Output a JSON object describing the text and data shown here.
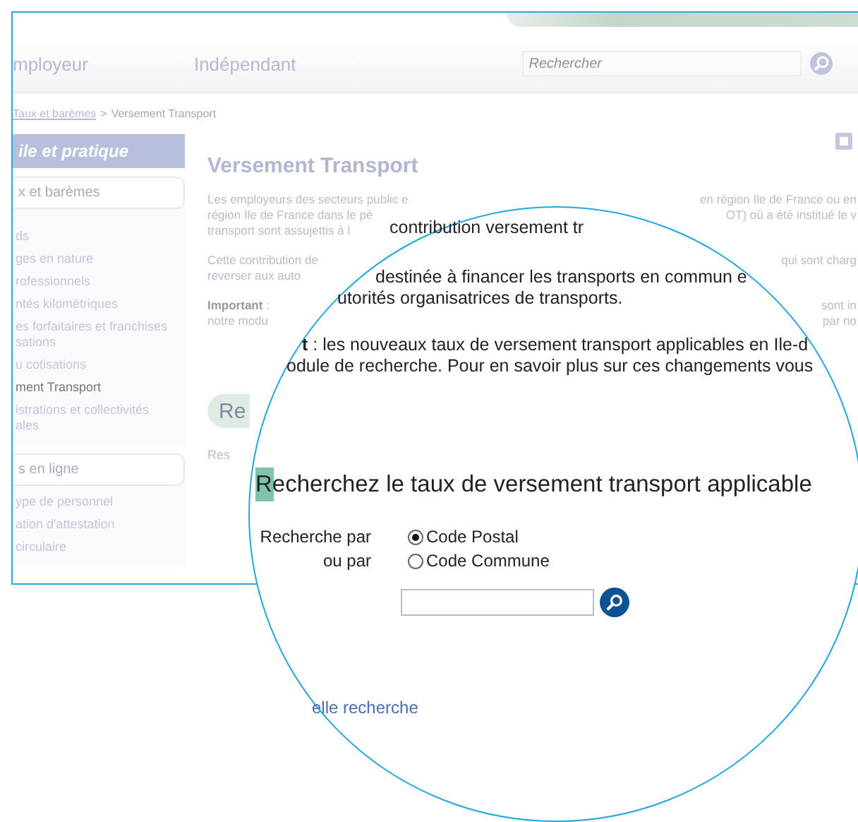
{
  "nav": {
    "items": [
      "mployeur",
      "Indépendant"
    ],
    "search_placeholder": "Rechercher"
  },
  "breadcrumb": {
    "link": "Taux et barèmes",
    "separator": ">",
    "current": "Versement Transport"
  },
  "sidebar": {
    "header": "ile et pratique",
    "sections": [
      {
        "title": "x et barèmes",
        "items": [
          {
            "label": "ds",
            "selected": false
          },
          {
            "label": "ges en nature",
            "selected": false
          },
          {
            "label": "rofessionnels",
            "selected": false
          },
          {
            "label": "ntés kilométriques",
            "selected": false
          },
          {
            "label": "es forfaitaires et franchises\nsations",
            "selected": false
          },
          {
            "label": "u cotisations",
            "selected": false
          },
          {
            "label": "ment Transport",
            "selected": true
          },
          {
            "label": "istrations et collectivités\nales",
            "selected": false
          }
        ]
      },
      {
        "title": "s en ligne",
        "items": [
          {
            "label": "ype de personnel",
            "selected": false
          },
          {
            "label": "ation d'attestation",
            "selected": false
          },
          {
            "label": "circulaire",
            "selected": false
          }
        ]
      }
    ]
  },
  "main": {
    "title": "Versement Transport",
    "paragraphs": [
      [
        {
          "left": "Les employeurs des secteurs public e",
          "right": "en région Ile de France ou en"
        },
        {
          "left": "région Ile de France dans le pé",
          "right": "OT) où a été institué le v"
        },
        {
          "left": "transport sont assujettis à l"
        }
      ],
      [
        {
          "left": "Cette contribution de",
          "right": "qui sont charg"
        },
        {
          "left": "reverser aux auto"
        }
      ],
      [
        {
          "left": "**Important** :",
          "right": "sont in"
        },
        {
          "left": "notre modu",
          "right": "par no"
        }
      ]
    ],
    "button": "Re",
    "subtext": "Res"
  },
  "magnifier": {
    "lines": [
      "contribution versement tr",
      "destinée à financer les transports en commun e",
      "utorités organisatrices de transports.",
      "**t** : les nouveaux taux de versement transport applicables en Ile-d",
      "odule de recherche. Pour en savoir plus sur ces changements vous"
    ],
    "heading": "Recherchez le taux de versement transport applicable",
    "options": [
      {
        "prefix": "Recherche par",
        "label": "Code Postal",
        "selected": true
      },
      {
        "prefix": "ou par",
        "label": "Code Commune",
        "selected": false
      }
    ],
    "link": "elle recherche"
  }
}
